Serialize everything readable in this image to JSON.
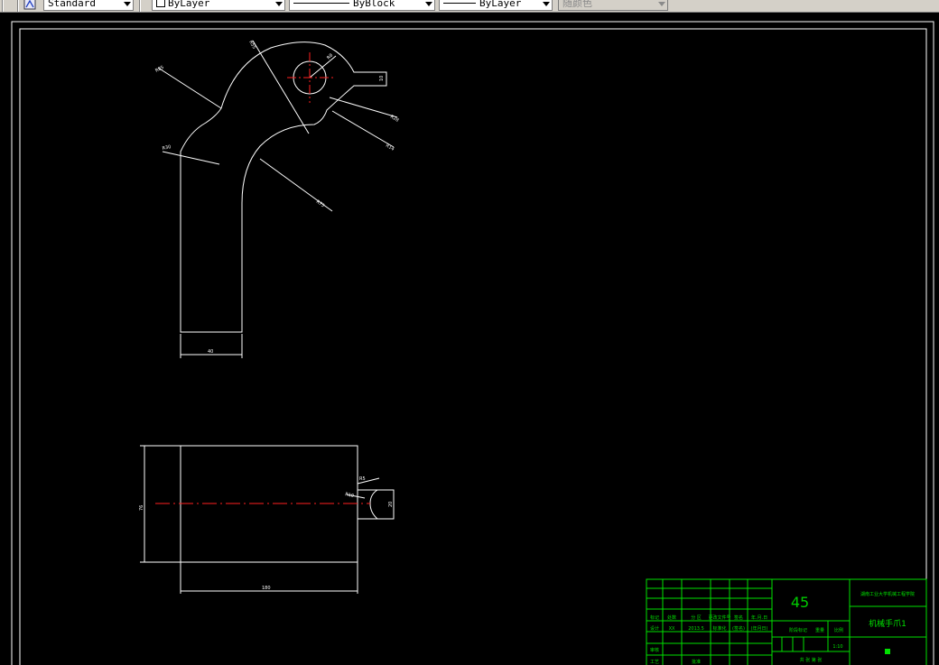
{
  "toolbar": {
    "text_style": "Standard",
    "layer": "ByLayer",
    "linetype": "ByBlock",
    "lineweight": "ByLayer",
    "plot_color": "随颜色"
  },
  "drawing": {
    "colors": {
      "background": "#000000",
      "lines": "#ffffff",
      "centerlines": "#ff2020",
      "title_block": "#00ff00"
    },
    "top_view_dims": {
      "r_big": "R85",
      "r_top": "R55",
      "r_hole": "R8",
      "w_notch": "10",
      "r_a": "R28",
      "r_b": "R14",
      "r_left": "R30",
      "r_inner": "R75",
      "width": "40"
    },
    "side_view_dims": {
      "height": "76",
      "length": "180",
      "slot_r": "R5",
      "slot_a": "R10",
      "slot_h": "20"
    }
  },
  "title_block": {
    "material": "45",
    "school": "湖南工业大学机械工程学院",
    "drawing_name": "机械手爪1",
    "scale": "1:10",
    "sheets": "共 张  第 张",
    "rows": [
      [
        "标记",
        "处数",
        "分 区",
        "更改文件号",
        "签名",
        "年.月.日"
      ],
      [
        "设计",
        "XX",
        "2013.5",
        "标准化",
        "(签名)",
        "(年月日)"
      ],
      [
        "审核",
        "",
        "",
        "",
        "",
        ""
      ],
      [
        "工艺",
        "",
        "批准",
        "",
        "",
        ""
      ]
    ],
    "labels": {
      "stage": "阶段标记",
      "weight": "重量",
      "ratio": "比例"
    }
  }
}
